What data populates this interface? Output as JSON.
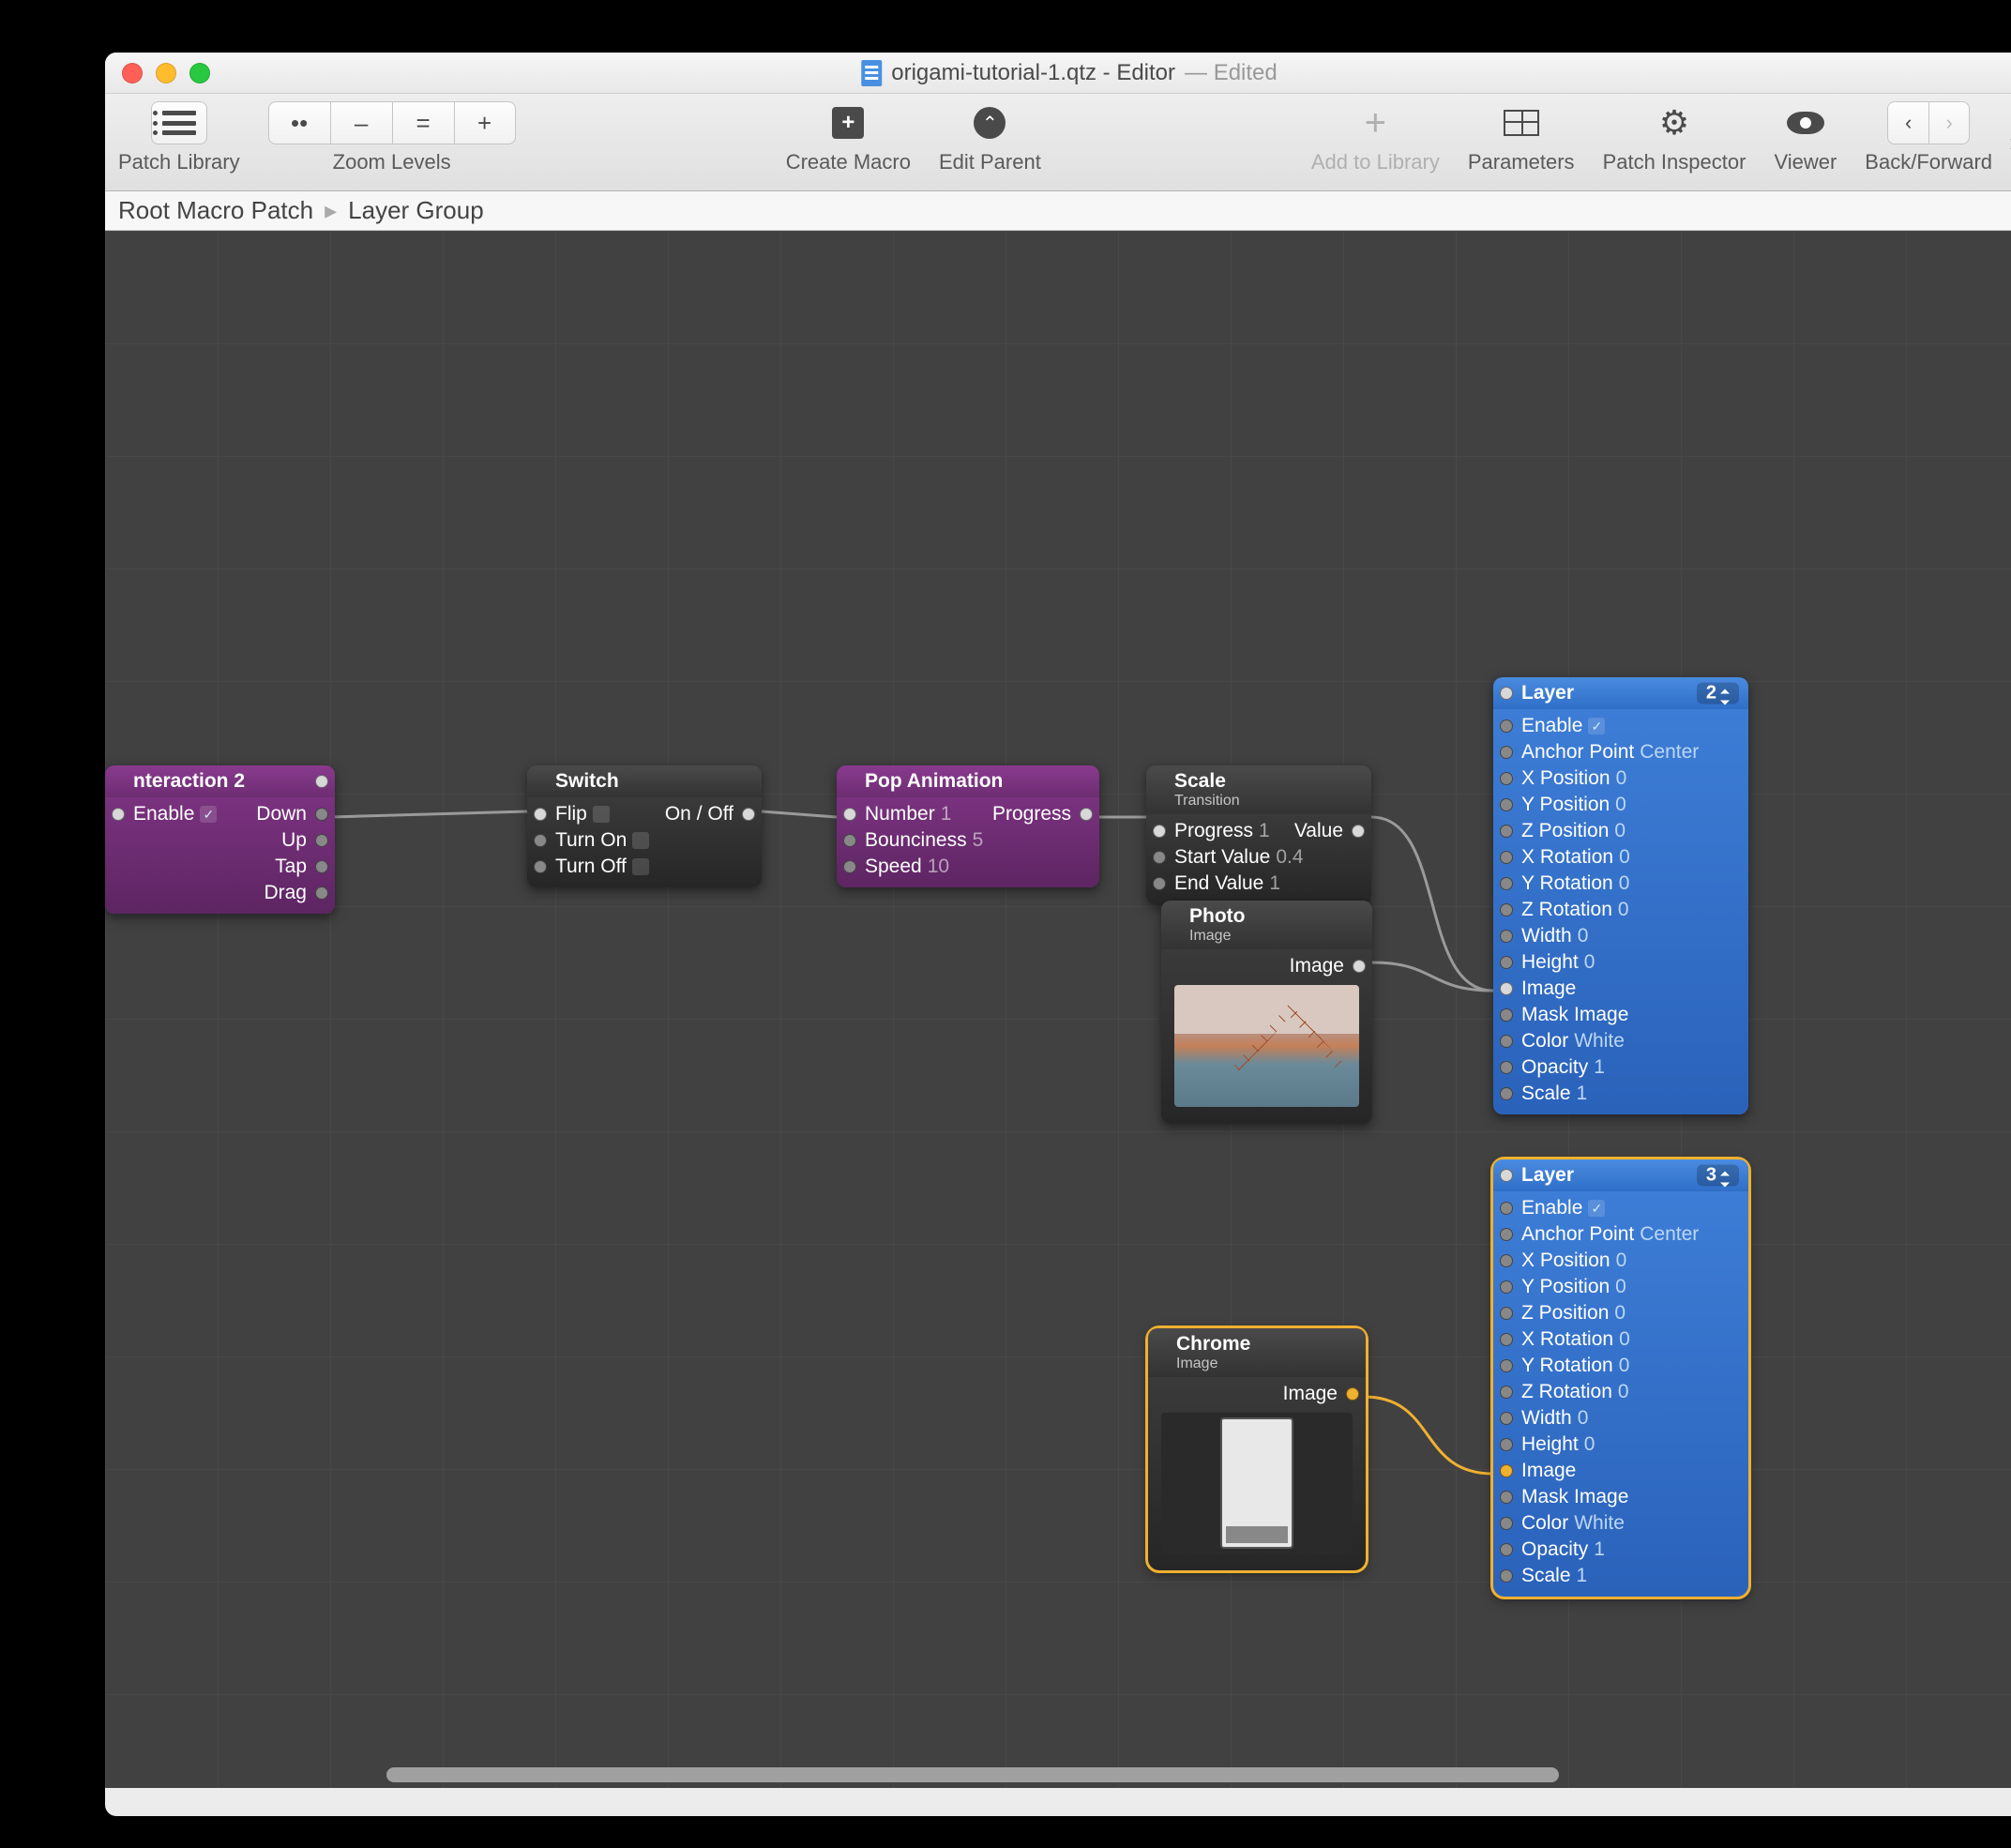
{
  "window": {
    "title": "origami-tutorial-1.qtz - Editor",
    "edited": "— Edited"
  },
  "toolbar": {
    "patch_library": "Patch Library",
    "zoom_levels": "Zoom Levels",
    "zoom_dots": "••",
    "zoom_minus": "–",
    "zoom_eq": "=",
    "zoom_plus": "+",
    "create_macro": "Create Macro",
    "edit_parent": "Edit Parent",
    "add_to_library": "Add to Library",
    "parameters": "Parameters",
    "patch_inspector": "Patch Inspector",
    "viewer": "Viewer",
    "back_forward": "Back/Forward",
    "back": "‹",
    "forward": "›"
  },
  "breadcrumb": {
    "root": "Root Macro Patch",
    "sep": "▸",
    "current": "Layer Group"
  },
  "nodes": {
    "interaction": {
      "title": "nteraction 2",
      "enable": "Enable",
      "down": "Down",
      "up": "Up",
      "tap": "Tap",
      "drag": "Drag"
    },
    "switch": {
      "title": "Switch",
      "flip": "Flip",
      "turn_on": "Turn On",
      "turn_off": "Turn Off",
      "on_off": "On / Off"
    },
    "pop": {
      "title": "Pop Animation",
      "number": "Number",
      "number_v": "1",
      "bounciness": "Bounciness",
      "bounciness_v": "5",
      "speed": "Speed",
      "speed_v": "10",
      "progress": "Progress"
    },
    "scale": {
      "title": "Scale",
      "sub": "Transition",
      "progress": "Progress",
      "progress_v": "1",
      "start": "Start Value",
      "start_v": "0.4",
      "end": "End Value",
      "end_v": "1",
      "value": "Value"
    },
    "photo": {
      "title": "Photo",
      "sub": "Image",
      "image": "Image"
    },
    "chrome": {
      "title": "Chrome",
      "sub": "Image",
      "image": "Image"
    },
    "layer2": {
      "title": "Layer",
      "num": "2",
      "rows": [
        {
          "k": "Enable",
          "v": "✓",
          "chk": true
        },
        {
          "k": "Anchor Point",
          "v": "Center"
        },
        {
          "k": "X Position",
          "v": "0"
        },
        {
          "k": "Y Position",
          "v": "0"
        },
        {
          "k": "Z Position",
          "v": "0"
        },
        {
          "k": "X Rotation",
          "v": "0"
        },
        {
          "k": "Y Rotation",
          "v": "0"
        },
        {
          "k": "Z Rotation",
          "v": "0"
        },
        {
          "k": "Width",
          "v": "0"
        },
        {
          "k": "Height",
          "v": "0"
        },
        {
          "k": "Image",
          "v": ""
        },
        {
          "k": "Mask Image",
          "v": ""
        },
        {
          "k": "Color",
          "v": "White"
        },
        {
          "k": "Opacity",
          "v": "1"
        },
        {
          "k": "Scale",
          "v": "1"
        }
      ]
    },
    "layer3": {
      "title": "Layer",
      "num": "3",
      "rows": [
        {
          "k": "Enable",
          "v": "✓",
          "chk": true
        },
        {
          "k": "Anchor Point",
          "v": "Center"
        },
        {
          "k": "X Position",
          "v": "0"
        },
        {
          "k": "Y Position",
          "v": "0"
        },
        {
          "k": "Z Position",
          "v": "0"
        },
        {
          "k": "X Rotation",
          "v": "0"
        },
        {
          "k": "Y Rotation",
          "v": "0"
        },
        {
          "k": "Z Rotation",
          "v": "0"
        },
        {
          "k": "Width",
          "v": "0"
        },
        {
          "k": "Height",
          "v": "0"
        },
        {
          "k": "Image",
          "v": ""
        },
        {
          "k": "Mask Image",
          "v": ""
        },
        {
          "k": "Color",
          "v": "White"
        },
        {
          "k": "Opacity",
          "v": "1"
        },
        {
          "k": "Scale",
          "v": "1"
        }
      ]
    }
  }
}
